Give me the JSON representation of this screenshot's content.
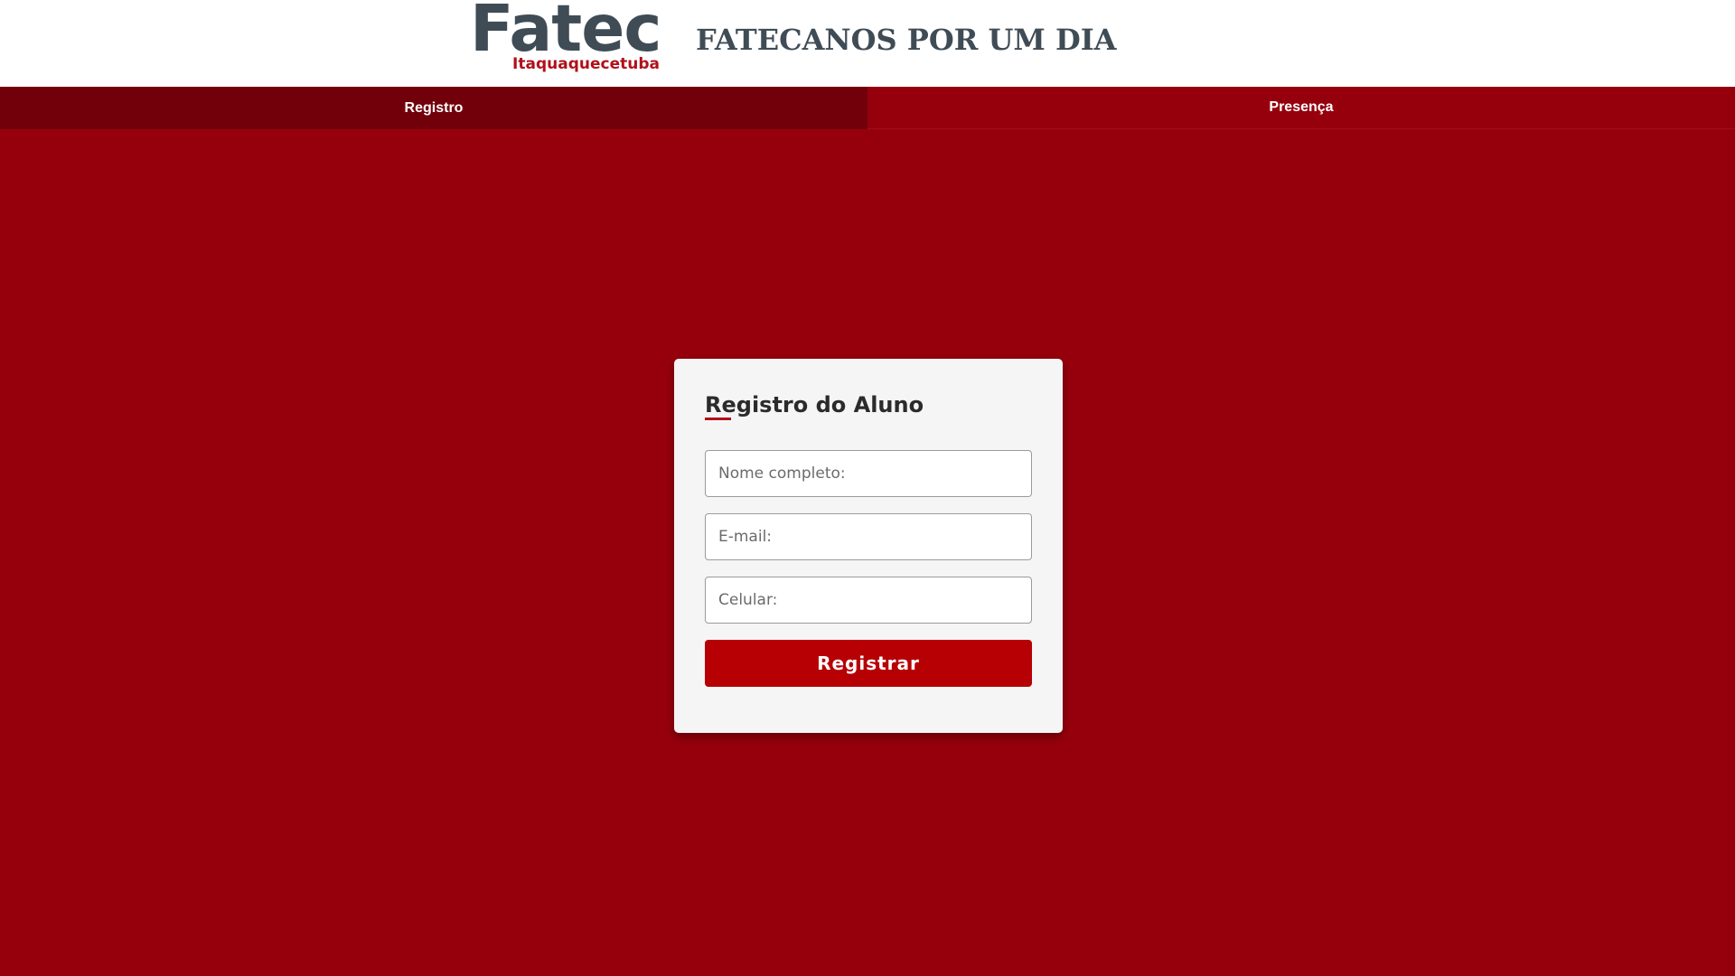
{
  "header": {
    "logo": {
      "word": "Fatec",
      "subtitle": "Itaquaquecetuba"
    },
    "title": "FATECANOS POR UM DIA"
  },
  "nav": {
    "tabs": [
      {
        "label": "Registro",
        "active": true
      },
      {
        "label": "Presença",
        "active": false
      }
    ]
  },
  "form": {
    "title": "Registro do Aluno",
    "fields": {
      "name": {
        "placeholder": "Nome completo:",
        "value": ""
      },
      "email": {
        "placeholder": "E-mail:",
        "value": ""
      },
      "phone": {
        "placeholder": "Celular:",
        "value": ""
      }
    },
    "submit_label": "Registrar"
  },
  "colors": {
    "background": "#96000c",
    "nav_active": "#72000a",
    "button": "#b60004",
    "logo_text": "#3f4c56",
    "logo_accent": "#b0101b",
    "card": "#f5f5f5"
  }
}
